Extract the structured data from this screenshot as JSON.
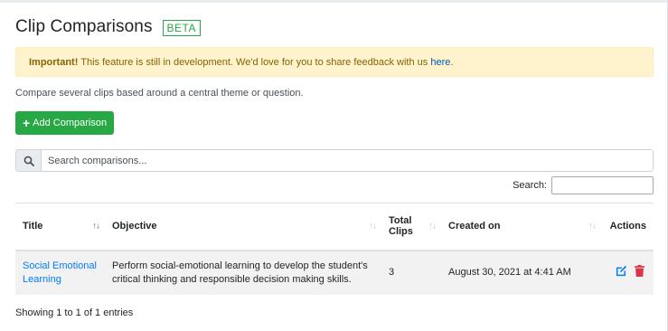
{
  "page": {
    "title": "Clip Comparisons",
    "badge": "BETA"
  },
  "alert": {
    "strong": "Important!",
    "text": " This feature is still in development. We'd love for you to share feedback with us ",
    "link": "here",
    "end": "."
  },
  "intro": "Compare several clips based around a central theme or question.",
  "add_button": {
    "icon": "plus-icon",
    "label": "Add Comparison"
  },
  "search": {
    "icon": "search-icon",
    "placeholder": "Search comparisons..."
  },
  "dt_search": {
    "label": "Search:"
  },
  "table": {
    "columns": [
      {
        "label": "Title"
      },
      {
        "label": "Objective"
      },
      {
        "label_line1": "Total",
        "label_line2": "Clips"
      },
      {
        "label": "Created on"
      },
      {
        "label": "Actions"
      }
    ],
    "rows": [
      {
        "title": "Social Emotional Learning",
        "objective": "Perform social-emotional learning to develop the student's critical thinking and responsible decision making skills.",
        "total_clips": "3",
        "created_on": "August 30, 2021 at 4:41 AM",
        "actions": [
          "edit-icon",
          "trash-icon"
        ]
      }
    ]
  },
  "info": "Showing 1 to 1 of 1 entries",
  "colors": {
    "success": "#28a745",
    "link": "#007bff",
    "danger": "#dc3545",
    "alert_bg": "#fff3cd"
  }
}
